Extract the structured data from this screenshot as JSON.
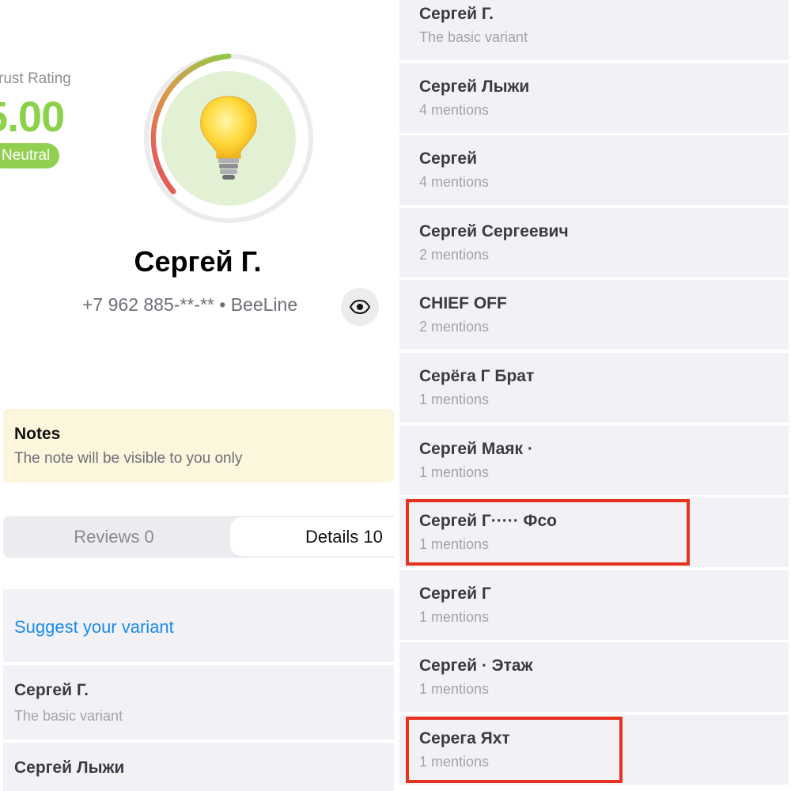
{
  "profile": {
    "trust_label": "rust Rating",
    "trust_value": "5.00",
    "badge": "Neutral",
    "name": "Сергей Г.",
    "phone_carrier": "+7 962 885-**-** • BeeLine",
    "icons": {
      "gauge_center": "lightbulb-icon",
      "reveal": "eye-icon"
    },
    "colors": {
      "rating_green": "#8bd14a",
      "gauge_red": "#e8485a",
      "gauge_yellow": "#d8c24a",
      "gauge_green": "#9ccc45"
    }
  },
  "notes": {
    "title": "Notes",
    "hint": "The note will be visible to you only"
  },
  "tabs": [
    {
      "label": "Reviews 0",
      "active": false
    },
    {
      "label": "Details 10",
      "active": true
    }
  ],
  "suggest_link": "Suggest your variant",
  "left_list": [
    {
      "name": "Сергей Г.",
      "sub": "The basic variant"
    },
    {
      "name": "Сергей Лыжи",
      "sub": ""
    }
  ],
  "right_list": [
    {
      "name": "Сергей Г.",
      "sub": "The basic variant"
    },
    {
      "name": "Сергей Лыжи",
      "sub": "4 mentions"
    },
    {
      "name": "Сергей",
      "sub": "4 mentions"
    },
    {
      "name": "Сергей Сергеевич",
      "sub": "2 mentions"
    },
    {
      "name": "CHIEF OFF",
      "sub": "2 mentions"
    },
    {
      "name": "Серёга Г Брат",
      "sub": "1 mentions"
    },
    {
      "name": "Сергей Маяк ·",
      "sub": "1 mentions"
    },
    {
      "name": "Сергей Г····· Фсо",
      "sub": "1 mentions",
      "highlighted": true
    },
    {
      "name": "Сергей Г",
      "sub": "1 mentions"
    },
    {
      "name": "Сергей · Этаж",
      "sub": "1 mentions"
    },
    {
      "name": "Серега Яхт",
      "sub": "1 mentions",
      "highlighted": true
    }
  ],
  "highlight_color": "#e63320"
}
